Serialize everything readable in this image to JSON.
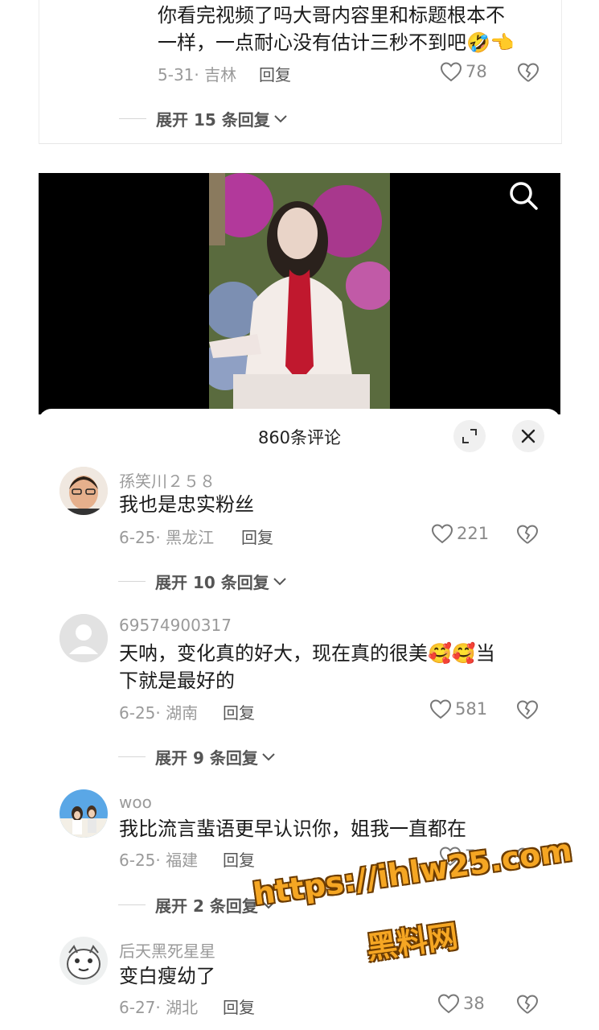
{
  "top_comment": {
    "text_line1": "你看完视频了吗大哥内容里和标题根本不",
    "text_line2": "一样，一点耐心没有估计三秒不到吧",
    "emoji": "🤣👈",
    "date_location": "5-31· 吉林",
    "reply": "回复",
    "likes": "78",
    "expand": "展开 15 条回复"
  },
  "video": {
    "search_icon": "search-icon"
  },
  "panel": {
    "title": "860条评论",
    "expand_icon": "fullscreen-icon",
    "close_icon": "close-icon",
    "comments": [
      {
        "name": "孫笑川２５８",
        "text_line1": "我也是忠实粉丝",
        "text_line2": "",
        "date_location": "6-25· 黑龙江",
        "reply": "回复",
        "likes": "221",
        "expand": "展开 10 条回复"
      },
      {
        "name": "69574900317",
        "text_line1": "天呐，变化真的好大，现在真的很美🥰🥰当",
        "text_line2": "下就是最好的",
        "date_location": "6-25· 湖南",
        "reply": "回复",
        "likes": "581",
        "expand": "展开 9 条回复"
      },
      {
        "name": "woo",
        "text_line1": "我比流言蜚语更早认识你，姐我一直都在",
        "text_line2": "",
        "date_location": "6-25· 福建",
        "reply": "回复",
        "likes": "75",
        "expand": "展开 2 条回复"
      },
      {
        "name": "后天黑死星星",
        "text_line1": "变白瘦幼了",
        "text_line2": "",
        "date_location": "6-27· 湖北",
        "reply": "回复",
        "likes": "38",
        "expand": ""
      }
    ]
  },
  "watermark": {
    "url": "https://ihlw25.com",
    "name": "黑料网"
  },
  "colors": {
    "accent_watermark": "#f5a623",
    "muted_text": "#9a9a9a",
    "panel_bg": "#ffffff",
    "video_bg": "#000000"
  }
}
